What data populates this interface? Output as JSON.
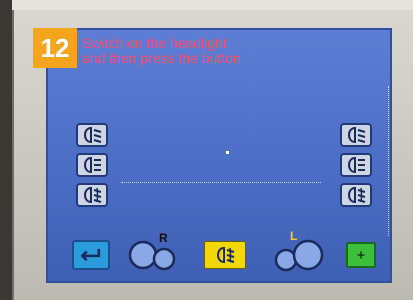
{
  "step": "12",
  "instruction": {
    "line1": "Switch on the headlight",
    "line2": "and then press the button"
  },
  "labels": {
    "r_marker": "R",
    "l_marker": "L"
  },
  "colors": {
    "screen": "#4e6fc6",
    "accent_orange": "#f3a51b",
    "instruction_text": "#ff4d6a",
    "yellow_button": "#f5d800",
    "green_button": "#3cbf3c",
    "back_button": "#2b9bdc"
  },
  "icons": {
    "left": [
      "low-beam-headlight-icon",
      "high-beam-headlight-icon",
      "fog-light-icon"
    ],
    "right": [
      "low-beam-headlight-icon",
      "high-beam-headlight-icon",
      "fog-light-icon"
    ],
    "bottom": [
      "back-arrow-icon",
      "right-headlight-circles-icon",
      "fog-light-icon",
      "left-headlight-circles-icon",
      "confirm-plus-icon"
    ]
  }
}
